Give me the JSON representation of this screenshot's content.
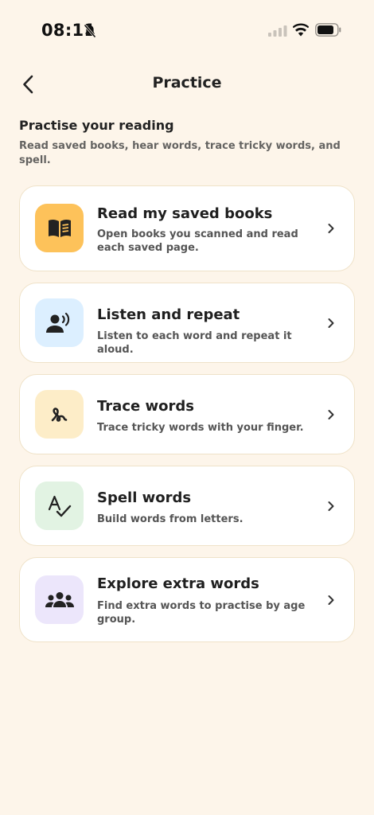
{
  "status_bar": {
    "time": "08:11"
  },
  "header": {
    "title": "Practice"
  },
  "intro": {
    "title": "Practise your reading",
    "description": "Read saved books, hear words, trace tricky words, and spell."
  },
  "cards": [
    {
      "title": "Read my saved books",
      "description": "Open books you scanned and read each saved page.",
      "icon": "book-icon",
      "icon_bg": "#fdc25a"
    },
    {
      "title": "Listen and repeat",
      "description": "Listen to each word and repeat it aloud.",
      "icon": "speaking-person-icon",
      "icon_bg": "#dcefff"
    },
    {
      "title": "Trace words",
      "description": "Trace tricky words with your finger.",
      "icon": "squiggle-icon",
      "icon_bg": "#fdedc8"
    },
    {
      "title": "Spell words",
      "description": "Build words from letters.",
      "icon": "spellcheck-icon",
      "icon_bg": "#e2f3e3"
    },
    {
      "title": "Explore extra words",
      "description": "Find extra words to practise by age group.",
      "icon": "group-icon",
      "icon_bg": "#ece6fb"
    }
  ]
}
